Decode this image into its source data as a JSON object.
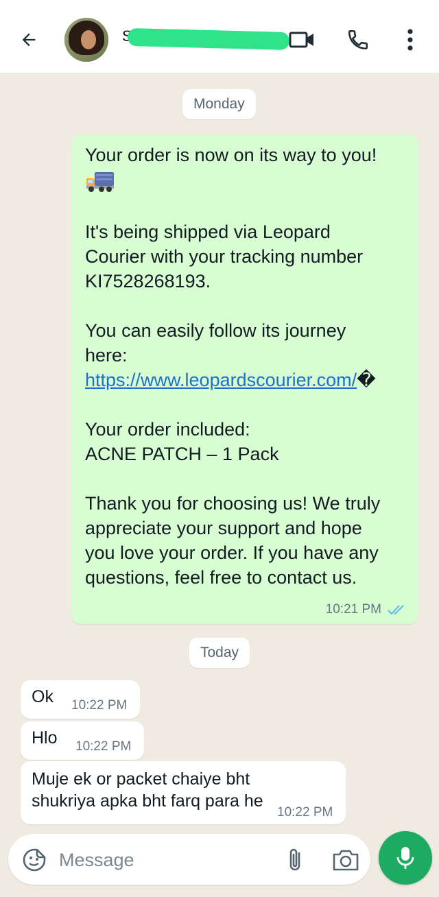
{
  "header": {
    "contact_name": "Sa",
    "icons": [
      "back-arrow-icon",
      "video-call-icon",
      "phone-icon",
      "more-vert-icon"
    ]
  },
  "chat": {
    "date_chips": [
      "Monday",
      "Today"
    ],
    "outgoing": {
      "line1": "Your order is now on its way to you!",
      "line2": "It's being shipped via Leopard",
      "line3": "Courier with your tracking number",
      "line4": "KI7528268193.",
      "line5": "You can easily follow its journey",
      "line6": "here:",
      "link": "https://www.leopardscourier.com/",
      "link_tail": "�",
      "line7": "Your order included:",
      "line8": "ACNE PATCH – 1 Pack",
      "line9": "Thank you for choosing us! We truly",
      "line10": "appreciate your support and hope",
      "line11": "you love your order. If you have any",
      "line12": "questions, feel free to contact us.",
      "time": "10:21 PM",
      "status": "read"
    },
    "incoming": [
      {
        "text": "Ok",
        "time": "10:22 PM"
      },
      {
        "text": "Hlo",
        "time": "10:22 PM"
      },
      {
        "text": "Muje ek or packet chaiye bht shukriya apka bht farq para he",
        "time": "10:22 PM"
      }
    ]
  },
  "composer": {
    "placeholder": "Message"
  },
  "colors": {
    "outgoing_bubble": "#d9fdd3",
    "incoming_bubble": "#ffffff",
    "accent_green": "#1daa61",
    "read_ticks": "#53bdeb",
    "link": "#1a73c9"
  }
}
